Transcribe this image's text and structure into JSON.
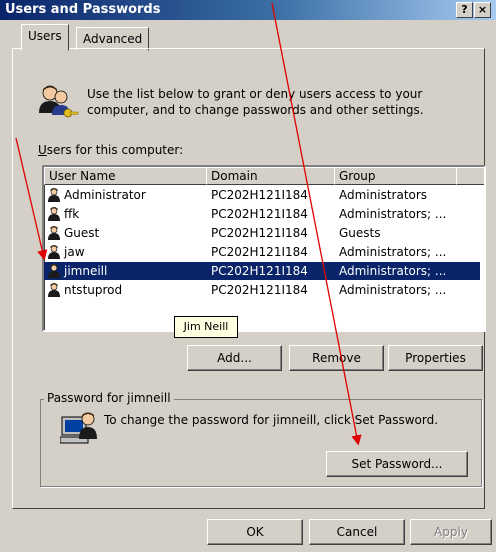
{
  "window": {
    "title": "Users and Passwords",
    "help_button": "?",
    "close_button": "×"
  },
  "tabs": [
    {
      "label": "Users",
      "active": true
    },
    {
      "label": "Advanced",
      "active": false
    }
  ],
  "intro_text": "Use the list below to grant or deny users access to your computer, and to change passwords and other settings.",
  "users_label": "Users for this computer:",
  "users_table": {
    "columns": [
      "User Name",
      "Domain",
      "Group"
    ],
    "rows": [
      {
        "name": "Administrator",
        "domain": "PC202H121I184",
        "group": "Administrators",
        "selected": false
      },
      {
        "name": "ffk",
        "domain": "PC202H121I184",
        "group": "Administrators; ...",
        "selected": false
      },
      {
        "name": "Guest",
        "domain": "PC202H121I184",
        "group": "Guests",
        "selected": false
      },
      {
        "name": "jaw",
        "domain": "PC202H121I184",
        "group": "Administrators; ...",
        "selected": false
      },
      {
        "name": "jimneill",
        "domain": "PC202H121I184",
        "group": "Administrators; ...",
        "selected": true
      },
      {
        "name": "ntstuprod",
        "domain": "PC202H121I184",
        "group": "Administrators; ...",
        "selected": false
      }
    ]
  },
  "tooltip": "Jim Neill",
  "buttons": {
    "add": "Add...",
    "remove": "Remove",
    "properties": "Properties",
    "set_password": "Set Password...",
    "ok": "OK",
    "cancel": "Cancel",
    "apply": "Apply"
  },
  "password_group": {
    "label": "Password for jimneill",
    "text": "To change the password for jimneill, click Set Password."
  },
  "colors": {
    "selection": "#0a246a",
    "annotation_arrow": "#e00000",
    "window_bg": "#d4d0c8"
  }
}
